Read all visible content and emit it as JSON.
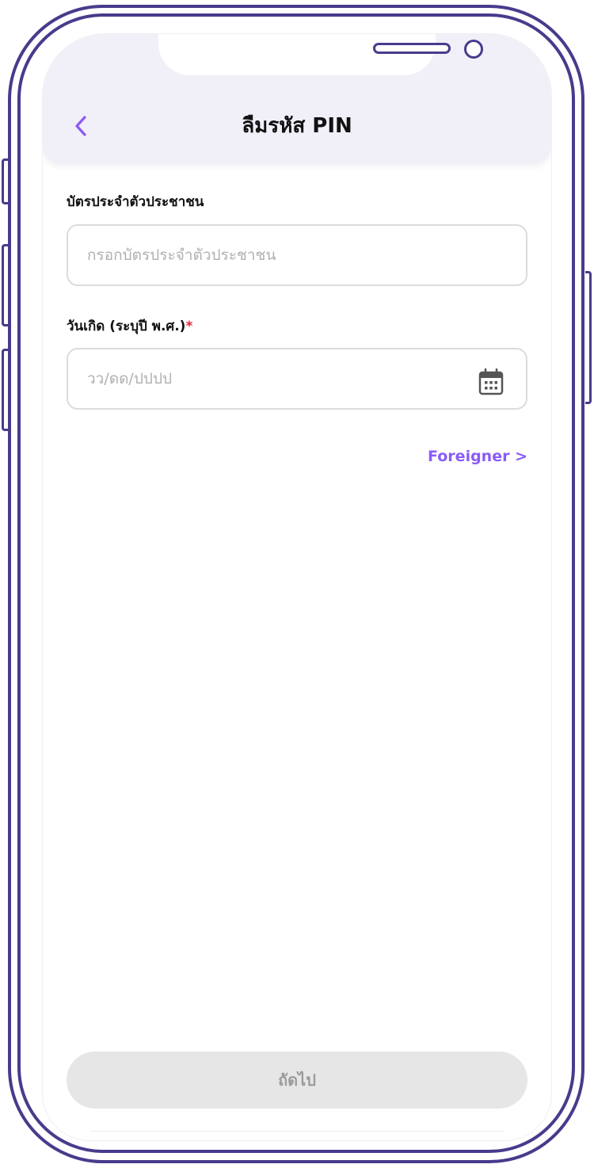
{
  "header": {
    "title": "ลืมรหัส PIN",
    "back_icon": "chevron-left-icon"
  },
  "form": {
    "id_card": {
      "label": "บัตรประจำตัวประชาชน",
      "placeholder": "กรอกบัตรประจำตัวประชาชน",
      "value": ""
    },
    "birth_date": {
      "label": "วันเกิด (ระบุปี พ.ศ.)",
      "required_mark": "*",
      "placeholder": "วว/ดด/ปปปป",
      "value": "",
      "icon": "calendar-icon"
    },
    "foreigner_link": "Foreigner >"
  },
  "footer": {
    "next_label": "ถัดไป",
    "next_enabled": false
  },
  "colors": {
    "frame": "#4a3a8c",
    "header_bg": "#f1eff8",
    "accent": "#8a5cf5",
    "required": "#e0263a",
    "button_disabled_bg": "#e6e6e6",
    "button_disabled_text": "#9b9b9b"
  }
}
